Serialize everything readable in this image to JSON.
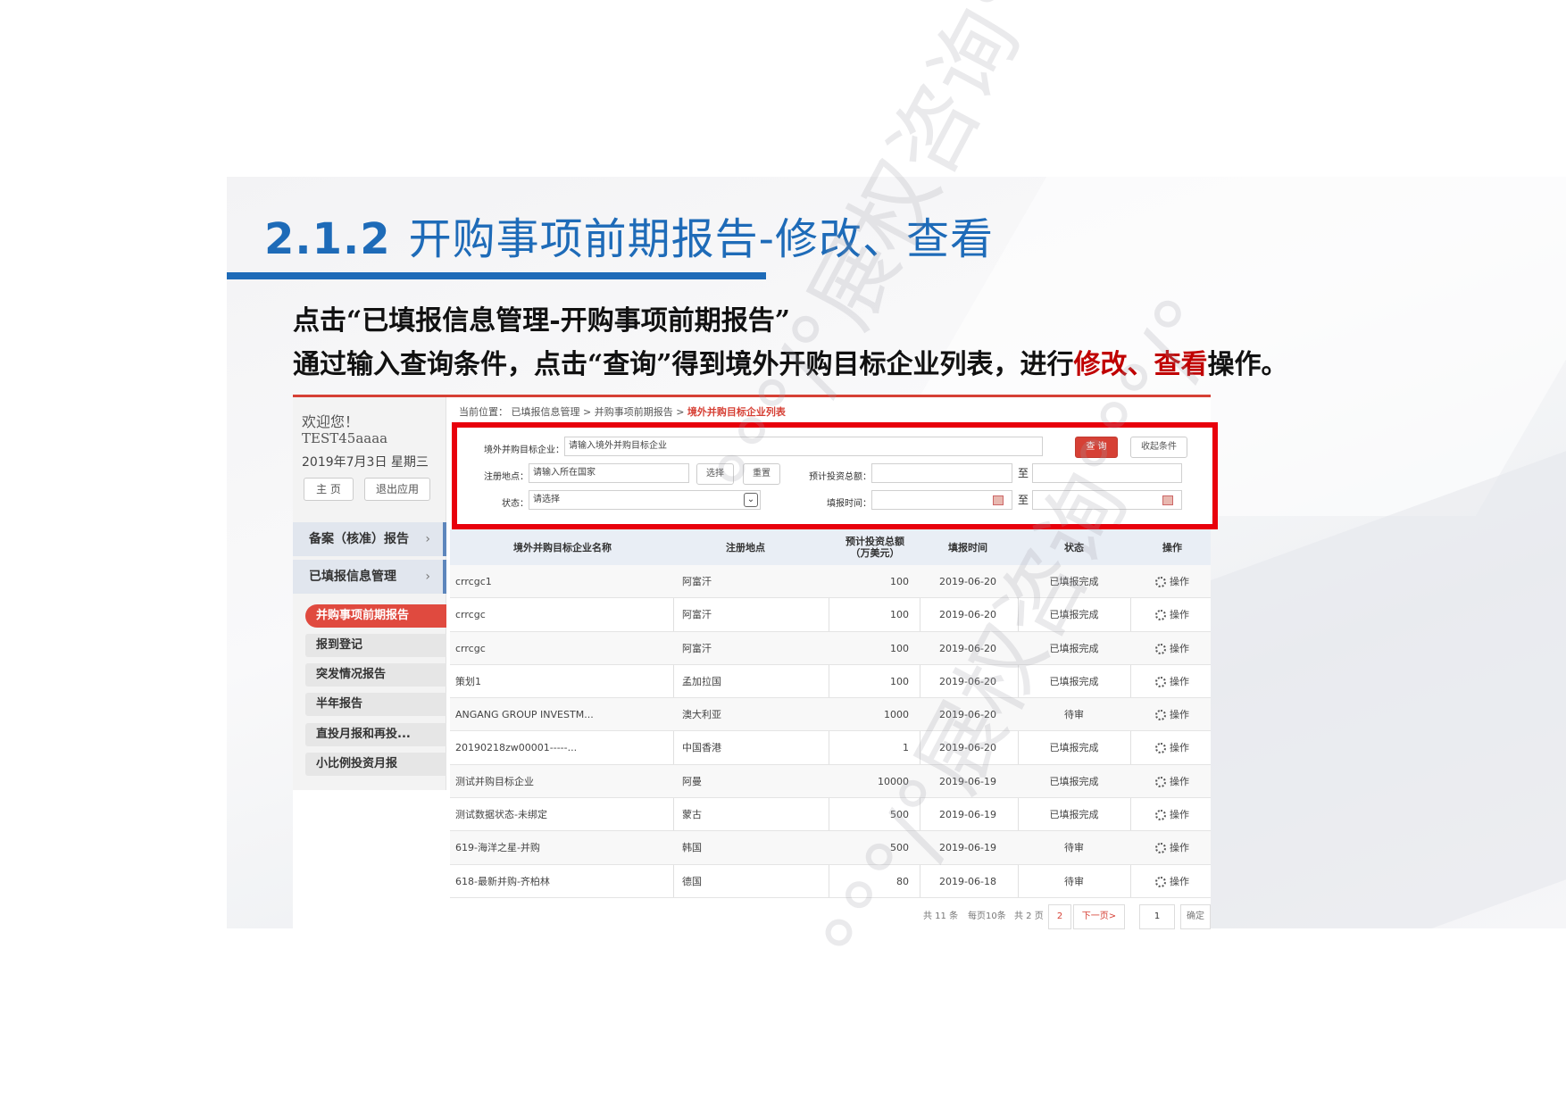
{
  "slide": {
    "title_num": "2.1.2",
    "title_text": "开购事项前期报告-修改、查看",
    "line1": "点击“已填报信息管理-开购事项前期报告”",
    "line2_a": "通过输入查询条件，点击“查询”得到境外开购目标企业列表，进行",
    "line2_hl1": "修改",
    "line2_sep": "、",
    "line2_hl2": "查看",
    "line2_b": "操作。",
    "watermark": "°°°/°展权咨询°°°/°"
  },
  "sidebar": {
    "welcome": "欢迎您！",
    "user": "TEST45aaaa",
    "date": "2019年7月3日 星期三",
    "home_btn": "主 页",
    "logout_btn": "退出应用",
    "nav": [
      {
        "label": "备案（核准）报告"
      },
      {
        "label": "已填报信息管理"
      }
    ],
    "subs": [
      {
        "label": "并购事项前期报告"
      },
      {
        "label": "报到登记"
      },
      {
        "label": "突发情况报告"
      },
      {
        "label": "半年报告"
      },
      {
        "label": "直投月报和再投..."
      },
      {
        "label": "小比例投资月报"
      }
    ]
  },
  "breadcrumb": {
    "prefix": "当前位置： 已填报信息管理 > 并购事项前期报告 > ",
    "current": "境外并购目标企业列表"
  },
  "filter": {
    "target_label": "境外并购目标企业：",
    "target_placeholder": "请输入境外并购目标企业",
    "query_btn": "查 询",
    "collapse_btn": "收起条件",
    "location_label": "注册地点：",
    "location_placeholder": "请输入所在国家",
    "select_btn": "选择",
    "reset_btn": "重置",
    "invest_label": "预计投资总额：",
    "to": "至",
    "status_label": "状态：",
    "status_value": "请选择",
    "date_label": "填报时间："
  },
  "table": {
    "headers": [
      "境外并购目标企业名称",
      "注册地点",
      "预计投资总额（万美元）",
      "填报时间",
      "状态",
      "操作"
    ],
    "rows": [
      {
        "name": "crrcgc1",
        "loc": "阿富汗",
        "amt": "100",
        "date": "2019-06-20",
        "status": "已填报完成",
        "op": "操作"
      },
      {
        "name": "crrcgc",
        "loc": "阿富汗",
        "amt": "100",
        "date": "2019-06-20",
        "status": "已填报完成",
        "op": "操作"
      },
      {
        "name": "crrcgc",
        "loc": "阿富汗",
        "amt": "100",
        "date": "2019-06-20",
        "status": "已填报完成",
        "op": "操作"
      },
      {
        "name": "策划1",
        "loc": "孟加拉国",
        "amt": "100",
        "date": "2019-06-20",
        "status": "已填报完成",
        "op": "操作"
      },
      {
        "name": "ANGANG GROUP INVESTM...",
        "loc": "澳大利亚",
        "amt": "1000",
        "date": "2019-06-20",
        "status": "待审",
        "op": "操作"
      },
      {
        "name": "20190218zw00001-----...",
        "loc": "中国香港",
        "amt": "1",
        "date": "2019-06-20",
        "status": "已填报完成",
        "op": "操作"
      },
      {
        "name": "测试并购目标企业",
        "loc": "阿曼",
        "amt": "10000",
        "date": "2019-06-19",
        "status": "已填报完成",
        "op": "操作"
      },
      {
        "name": "测试数据状态-未绑定",
        "loc": "蒙古",
        "amt": "500",
        "date": "2019-06-19",
        "status": "已填报完成",
        "op": "操作"
      },
      {
        "name": "619-海洋之星-并购",
        "loc": "韩国",
        "amt": "500",
        "date": "2019-06-19",
        "status": "待审",
        "op": "操作"
      },
      {
        "name": "618-最新并购-齐柏林",
        "loc": "德国",
        "amt": "80",
        "date": "2019-06-18",
        "status": "待审",
        "op": "操作"
      }
    ]
  },
  "pager": {
    "total": "共 11 条",
    "per_page": "每页10条",
    "pages": "共 2 页",
    "page2": "2",
    "next": "下一页>",
    "goto_value": "1",
    "confirm": "确定"
  },
  "colors": {
    "accent_blue": "#1e6bb8",
    "accent_red": "#d64035",
    "highlight_box": "#e8000c"
  }
}
